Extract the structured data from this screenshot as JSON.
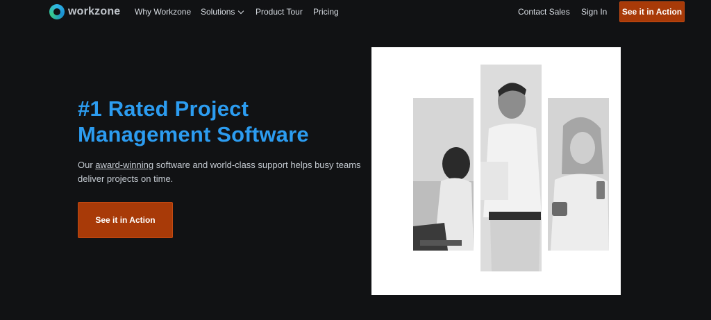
{
  "nav": {
    "logo_text": "workzone",
    "links": [
      "Why Workzone",
      "Solutions",
      "Product Tour",
      "Pricing"
    ],
    "contact_sales": "Contact Sales",
    "sign_in": "Sign In",
    "cta": "See it in Action"
  },
  "hero": {
    "headline_bold": "#1 Rated",
    "headline_rest": " Project Management Software",
    "subtext_before": "Our ",
    "subtext_link": "award-winning",
    "subtext_after": " software and world-class support helps busy teams deliver projects on time.",
    "cta": "See it in Action"
  },
  "icons": {
    "logo": "workzone-logo-icon",
    "dropdown": "chevron-down-icon"
  },
  "colors": {
    "background": "#111214",
    "accent_blue": "#2c9cf0",
    "cta_orange": "#a83a08"
  }
}
